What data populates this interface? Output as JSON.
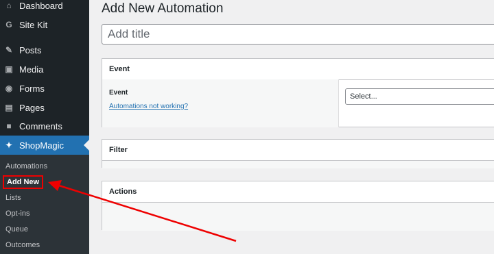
{
  "sidebar": {
    "items": [
      {
        "label": "Dashboard",
        "icon": "dashboard-icon",
        "glyph": "⌂"
      },
      {
        "label": "Site Kit",
        "icon": "google-g-icon",
        "glyph": "G"
      },
      {
        "label": "Posts",
        "icon": "pushpin-icon",
        "glyph": "✎"
      },
      {
        "label": "Media",
        "icon": "media-icon",
        "glyph": "▣"
      },
      {
        "label": "Forms",
        "icon": "forms-icon",
        "glyph": "◉"
      },
      {
        "label": "Pages",
        "icon": "pages-icon",
        "glyph": "▤"
      },
      {
        "label": "Comments",
        "icon": "comment-bubble-icon",
        "glyph": "■"
      },
      {
        "label": "ShopMagic",
        "icon": "magic-wand-icon",
        "glyph": "✦"
      }
    ],
    "submenu": [
      "Automations",
      "Add New",
      "Lists",
      "Opt-ins",
      "Queue",
      "Outcomes"
    ]
  },
  "page": {
    "title": "Add New Automation",
    "title_placeholder": "Add title"
  },
  "event_box": {
    "heading": "Event",
    "label": "Event",
    "help_link": "Automations not working?",
    "select_value": "Select..."
  },
  "filter_box": {
    "heading": "Filter"
  },
  "actions_box": {
    "heading": "Actions"
  },
  "colors": {
    "sidebar_bg": "#1d2327",
    "accent": "#2271b1",
    "highlight": "#e00000"
  }
}
